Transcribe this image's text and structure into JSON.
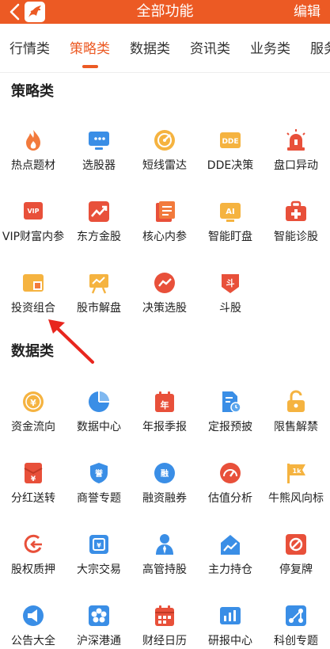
{
  "header": {
    "title": "全部功能",
    "edit_label": "编辑",
    "back_icon": "back-icon",
    "logo_icon": "app-logo-icon"
  },
  "tabs": [
    {
      "label": "行情类",
      "active": false
    },
    {
      "label": "策略类",
      "active": true
    },
    {
      "label": "数据类",
      "active": false
    },
    {
      "label": "资讯类",
      "active": false
    },
    {
      "label": "业务类",
      "active": false
    },
    {
      "label": "服务",
      "active": false
    }
  ],
  "colors": {
    "brand": "#ec5a24",
    "icon_orange": "#f27a3c",
    "icon_blue": "#3a8ee6",
    "icon_gold": "#f5b340",
    "icon_red": "#e8503a"
  },
  "sections": {
    "strategy": {
      "title": "策略类",
      "items": [
        {
          "label": "热点题材",
          "icon": "flame-icon"
        },
        {
          "label": "选股器",
          "icon": "monitor-icon"
        },
        {
          "label": "短线雷达",
          "icon": "radar-icon"
        },
        {
          "label": "DDE决策",
          "icon": "dde-icon"
        },
        {
          "label": "盘口异动",
          "icon": "alarm-icon"
        },
        {
          "label": "VIP财富内参",
          "icon": "vip-icon"
        },
        {
          "label": "东方金股",
          "icon": "trend-up-icon"
        },
        {
          "label": "核心内参",
          "icon": "report-icon"
        },
        {
          "label": "智能盯盘",
          "icon": "ai-icon"
        },
        {
          "label": "智能诊股",
          "icon": "medical-kit-icon"
        },
        {
          "label": "投资组合",
          "icon": "portfolio-icon"
        },
        {
          "label": "股市解盘",
          "icon": "presentation-icon"
        },
        {
          "label": "决策选股",
          "icon": "chart-circle-icon"
        },
        {
          "label": "斗股",
          "icon": "battle-icon"
        }
      ]
    },
    "data": {
      "title": "数据类",
      "items": [
        {
          "label": "资金流向",
          "icon": "coin-icon"
        },
        {
          "label": "数据中心",
          "icon": "pie-chart-icon"
        },
        {
          "label": "年报季报",
          "icon": "calendar-year-icon"
        },
        {
          "label": "定报预披",
          "icon": "document-clock-icon"
        },
        {
          "label": "限售解禁",
          "icon": "unlock-icon"
        },
        {
          "label": "分红送转",
          "icon": "red-envelope-icon"
        },
        {
          "label": "商誉专题",
          "icon": "shield-icon"
        },
        {
          "label": "融资融券",
          "icon": "margin-icon"
        },
        {
          "label": "估值分析",
          "icon": "gauge-icon"
        },
        {
          "label": "牛熊风向标",
          "icon": "flag-icon"
        },
        {
          "label": "股权质押",
          "icon": "pledge-icon"
        },
        {
          "label": "大宗交易",
          "icon": "block-trade-icon"
        },
        {
          "label": "高管持股",
          "icon": "executive-icon"
        },
        {
          "label": "主力持仓",
          "icon": "house-chart-icon"
        },
        {
          "label": "停复牌",
          "icon": "stop-icon"
        },
        {
          "label": "公告大全",
          "icon": "megaphone-icon"
        },
        {
          "label": "沪深港通",
          "icon": "hk-flower-icon"
        },
        {
          "label": "财经日历",
          "icon": "calendar-icon"
        },
        {
          "label": "研报中心",
          "icon": "research-chart-icon"
        },
        {
          "label": "科创专题",
          "icon": "tech-icon"
        }
      ]
    }
  }
}
